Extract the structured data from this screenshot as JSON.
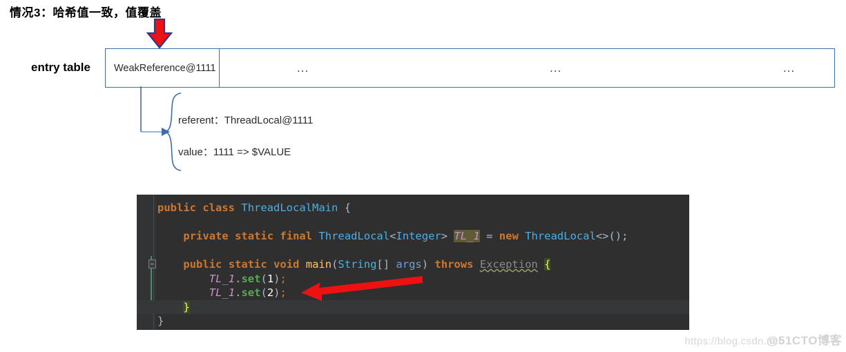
{
  "title": "情况3：哈希值一致，值覆盖",
  "diagram": {
    "entry_table_label": "entry table",
    "cells": {
      "first": "WeakReference@1111",
      "dots_1": "...",
      "dots_2": "...",
      "dots_3": "..."
    },
    "detail": {
      "referent": "referent：ThreadLocal@1111",
      "value": "value：1111  => $VALUE"
    }
  },
  "code": {
    "lines": [
      {
        "tokens": [
          {
            "t": "public",
            "c": "kw"
          },
          {
            "t": " ",
            "c": "plain"
          },
          {
            "t": "class",
            "c": "kw"
          },
          {
            "t": " ",
            "c": "plain"
          },
          {
            "t": "ThreadLocalMain",
            "c": "type"
          },
          {
            "t": " ",
            "c": "plain"
          },
          {
            "t": "{",
            "c": "plain"
          }
        ]
      },
      {
        "tokens": []
      },
      {
        "indent": 4,
        "tokens": [
          {
            "t": "private",
            "c": "kw"
          },
          {
            "t": " ",
            "c": "plain"
          },
          {
            "t": "static",
            "c": "kw"
          },
          {
            "t": " ",
            "c": "plain"
          },
          {
            "t": "final",
            "c": "kw"
          },
          {
            "t": " ",
            "c": "plain"
          },
          {
            "t": "ThreadLocal",
            "c": "type"
          },
          {
            "t": "<",
            "c": "punc"
          },
          {
            "t": "Integer",
            "c": "type"
          },
          {
            "t": "> ",
            "c": "punc"
          },
          {
            "t": "TL_1",
            "c": "field-hl"
          },
          {
            "t": " ",
            "c": "plain"
          },
          {
            "t": "=",
            "c": "punc"
          },
          {
            "t": " ",
            "c": "plain"
          },
          {
            "t": "new",
            "c": "kw"
          },
          {
            "t": " ",
            "c": "plain"
          },
          {
            "t": "ThreadLocal",
            "c": "type"
          },
          {
            "t": "<>();",
            "c": "punc"
          }
        ]
      },
      {
        "tokens": []
      },
      {
        "indent": 4,
        "tokens": [
          {
            "t": "public",
            "c": "kw"
          },
          {
            "t": " ",
            "c": "plain"
          },
          {
            "t": "static",
            "c": "kw"
          },
          {
            "t": " ",
            "c": "plain"
          },
          {
            "t": "void",
            "c": "kw"
          },
          {
            "t": " ",
            "c": "plain"
          },
          {
            "t": "main",
            "c": "fn"
          },
          {
            "t": "(",
            "c": "punc"
          },
          {
            "t": "String",
            "c": "type"
          },
          {
            "t": "[] ",
            "c": "punc"
          },
          {
            "t": "args",
            "c": "param"
          },
          {
            "t": ") ",
            "c": "punc"
          },
          {
            "t": "throws",
            "c": "kw"
          },
          {
            "t": " ",
            "c": "plain"
          },
          {
            "t": "Exception",
            "c": "warn"
          },
          {
            "t": " ",
            "c": "plain"
          },
          {
            "t": "{",
            "c": "brace-hl"
          }
        ]
      },
      {
        "indent": 8,
        "tokens": [
          {
            "t": "TL_1",
            "c": "field"
          },
          {
            "t": ".",
            "c": "punc"
          },
          {
            "t": "set",
            "c": "meth"
          },
          {
            "t": "(",
            "c": "punc"
          },
          {
            "t": "1",
            "c": "num"
          },
          {
            "t": ")",
            "c": "punc"
          },
          {
            "t": ";",
            "c": "semi"
          }
        ]
      },
      {
        "indent": 8,
        "tokens": [
          {
            "t": "TL_1",
            "c": "field"
          },
          {
            "t": ".",
            "c": "punc"
          },
          {
            "t": "set",
            "c": "meth"
          },
          {
            "t": "(",
            "c": "punc"
          },
          {
            "t": "2",
            "c": "num"
          },
          {
            "t": ")",
            "c": "punc"
          },
          {
            "t": ";",
            "c": "semi"
          }
        ]
      },
      {
        "indent": 4,
        "current": true,
        "tokens": [
          {
            "t": "}",
            "c": "brace-hl"
          }
        ]
      },
      {
        "indent": 0,
        "tokens": [
          {
            "t": "}",
            "c": "plain"
          }
        ]
      }
    ]
  },
  "watermark": {
    "url": "https://blog.csdn.net",
    "brand": "@51CTO博客"
  },
  "colors": {
    "table_border": "#3f6cab",
    "arrow_red": "#ee1111",
    "code_bg": "#2f2f2f",
    "gutter_bg": "#313335",
    "keyword": "#cc7832",
    "type": "#4eade5",
    "method": "#4caf50",
    "field": "#c792c7",
    "function": "#ffc66d"
  }
}
